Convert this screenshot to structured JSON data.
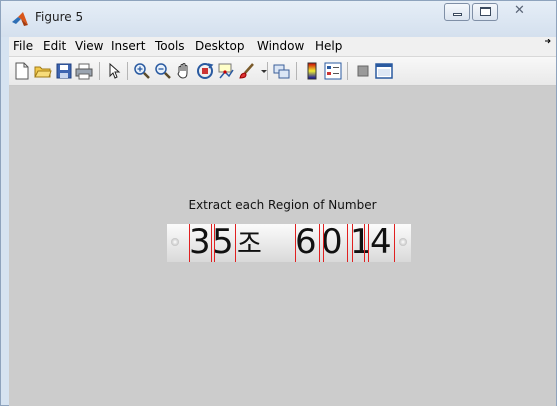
{
  "window": {
    "title": "Figure 5",
    "minimize_glyph": "",
    "maximize_glyph": "",
    "close_glyph": "✕"
  },
  "menu": {
    "items": [
      "File",
      "Edit",
      "View",
      "Insert",
      "Tools",
      "Desktop",
      "Window",
      "Help"
    ],
    "overflow": "➔"
  },
  "toolbar": {
    "tools": [
      "new-figure-icon",
      "open-file-icon",
      "save-figure-icon",
      "print-figure-icon",
      "edit-plot-icon",
      "zoom-in-icon",
      "zoom-out-icon",
      "pan-icon",
      "rotate-3d-icon",
      "data-cursor-icon",
      "brush-icon",
      "brush-dropdown-icon",
      "link-plot-icon",
      "insert-colorbar-icon",
      "insert-legend-icon",
      "hide-plot-tools-icon",
      "show-plot-tools-icon"
    ]
  },
  "figure": {
    "title": "Extract each Region of Number",
    "plate_text": [
      "3",
      "5",
      "조",
      "6",
      "0",
      "1",
      "4"
    ],
    "colors": {
      "background": "#cccccc",
      "segment_lines": "#e02020"
    }
  }
}
